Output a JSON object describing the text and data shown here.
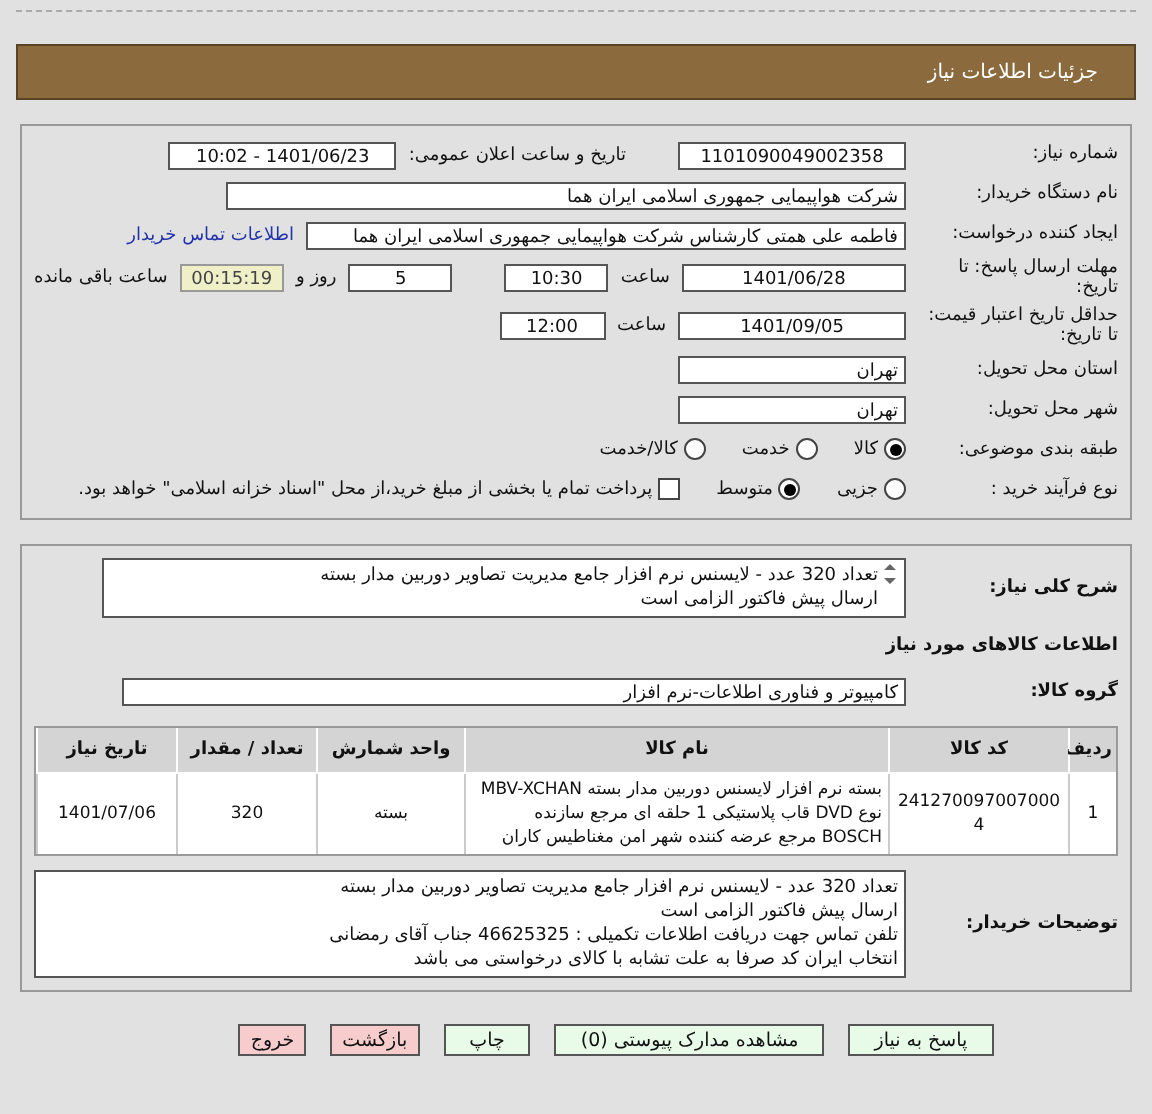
{
  "header": {
    "title": "جزئیات اطلاعات نیاز"
  },
  "details": {
    "need_number": {
      "label": "شماره نیاز:",
      "value": "1101090049002358"
    },
    "announce": {
      "label": "تاریخ و ساعت اعلان عمومی:",
      "value": "1401/06/23 - 10:02"
    },
    "buyer": {
      "label": "نام دستگاه خریدار:",
      "value": "شرکت هواپیمایی جمهوری اسلامی ایران هما"
    },
    "creator": {
      "label": "ایجاد کننده درخواست:",
      "value": "فاطمه علی همتی کارشناس شرکت هواپیمایی جمهوری اسلامی ایران هما",
      "link": "اطلاعات تماس خریدار"
    },
    "deadline": {
      "label": "مهلت ارسال پاسخ: تا تاریخ:",
      "date": "1401/06/28",
      "time_label": "ساعت",
      "time": "10:30",
      "days": "5",
      "days_label": "روز و",
      "remaining": "00:15:19",
      "remaining_label": "ساعت باقی مانده"
    },
    "validity": {
      "label": "حداقل تاریخ اعتبار قیمت: تا تاریخ:",
      "date": "1401/09/05",
      "time_label": "ساعت",
      "time": "12:00"
    },
    "province": {
      "label": "استان محل تحویل:",
      "value": "تهران"
    },
    "city": {
      "label": "شهر محل تحویل:",
      "value": "تهران"
    },
    "category": {
      "label": "طبقه بندی موضوعی:",
      "options": [
        {
          "label": "کالا",
          "selected": true
        },
        {
          "label": "خدمت",
          "selected": false
        },
        {
          "label": "کالا/خدمت",
          "selected": false
        }
      ]
    },
    "process": {
      "label": "نوع فرآیند خرید :",
      "options": [
        {
          "label": "جزیی",
          "selected": false
        },
        {
          "label": "متوسط",
          "selected": true
        }
      ],
      "treasury": {
        "label": "پرداخت تمام یا بخشی از مبلغ خرید،از محل \"اسناد خزانه اسلامی\" خواهد بود.",
        "checked": false
      }
    }
  },
  "needs": {
    "summary": {
      "label": "شرح کلی نیاز:",
      "lines": [
        "تعداد 320 عدد -  لایسنس نرم افزار جامع مدیریت تصاویر دوربین مدار بسته",
        "ارسال پیش فاکتور الزامی است"
      ]
    },
    "goods_heading": "اطلاعات کالاهای مورد نیاز",
    "group": {
      "label": "گروه کالا:",
      "value": "کامپیوتر و فناوری اطلاعات-نرم افزار"
    },
    "table": {
      "columns": [
        "ردیف",
        "کد کالا",
        "نام کالا",
        "واحد شمارش",
        "تعداد / مقدار",
        "تاریخ نیاز"
      ],
      "rows": [
        [
          "1",
          "2412700970070004",
          "بسته نرم افزار لایسنس دوربین مدار بسته MBV-XCHAN نوع DVD قاب پلاستیکی 1 حلقه ای مرجع سازنده BOSCH مرجع عرضه کننده شهر امن مغناطیس کاران",
          "بسته",
          "320",
          "1401/07/06"
        ]
      ]
    },
    "notes": {
      "label": "توضیحات خریدار:",
      "lines": [
        "تعداد 320 عدد -  لایسنس نرم افزار جامع مدیریت تصاویر دوربین مدار بسته",
        "ارسال پیش فاکتور الزامی است",
        "تلفن تماس جهت دریافت اطلاعات تکمیلی  :  46625325 جناب آقای رمضانی",
        "انتخاب ایران کد صرفا به علت تشابه با کالای درخواستی می باشد"
      ]
    }
  },
  "buttons": [
    {
      "label": "پاسخ به نیاز",
      "kind": "normal"
    },
    {
      "label": "مشاهده مدارک پیوستی (0)",
      "kind": "normal"
    },
    {
      "label": "چاپ",
      "kind": "normal"
    },
    {
      "label": "بازگشت",
      "kind": "danger"
    },
    {
      "label": "خروج",
      "kind": "danger"
    }
  ]
}
